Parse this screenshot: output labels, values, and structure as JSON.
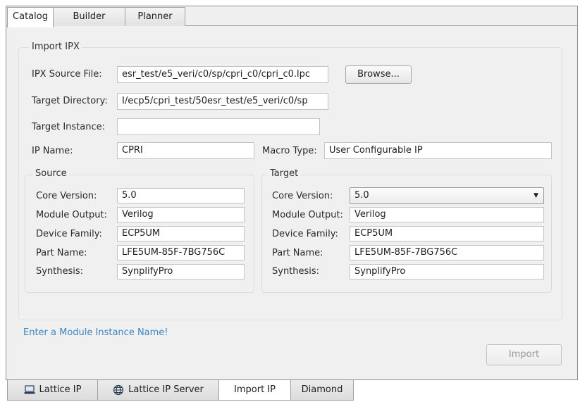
{
  "top_tabs": [
    "Catalog",
    "Builder",
    "Planner"
  ],
  "group": {
    "title": "Import IPX",
    "ipx_source_label": "IPX Source File:",
    "ipx_source_value": "esr_test/e5_veri/c0/sp/cpri_c0/cpri_c0.lpc",
    "browse_label": "Browse...",
    "target_dir_label": "Target Directory:",
    "target_dir_value": "I/ecp5/cpri_test/50esr_test/e5_veri/c0/sp",
    "target_instance_label": "Target Instance:",
    "target_instance_value": "",
    "ip_name_label": "IP Name:",
    "ip_name_value": "CPRI",
    "macro_type_label": "Macro Type:",
    "macro_type_value": "User Configurable IP"
  },
  "source": {
    "title": "Source",
    "core_version_label": "Core Version:",
    "core_version": "5.0",
    "module_output_label": "Module Output:",
    "module_output": "Verilog",
    "device_family_label": "Device Family:",
    "device_family": "ECP5UM",
    "part_name_label": "Part Name:",
    "part_name": "LFE5UM-85F-7BG756C",
    "synthesis_label": "Synthesis:",
    "synthesis": "SynplifyPro"
  },
  "target": {
    "title": "Target",
    "core_version_label": "Core Version:",
    "core_version": "5.0",
    "module_output_label": "Module Output:",
    "module_output": "Verilog",
    "device_family_label": "Device Family:",
    "device_family": "ECP5UM",
    "part_name_label": "Part Name:",
    "part_name": "LFE5UM-85F-7BG756C",
    "synthesis_label": "Synthesis:",
    "synthesis": "SynplifyPro"
  },
  "status_message": "Enter a Module Instance Name!",
  "import_label": "Import",
  "bottom_tabs": {
    "lattice_ip": "Lattice IP",
    "lattice_ip_server": "Lattice IP Server",
    "import_ip": "Import IP",
    "diamond": "Diamond"
  },
  "colors": {
    "status_text": "#3c86c4",
    "panel_background": "#f0f0f0"
  }
}
